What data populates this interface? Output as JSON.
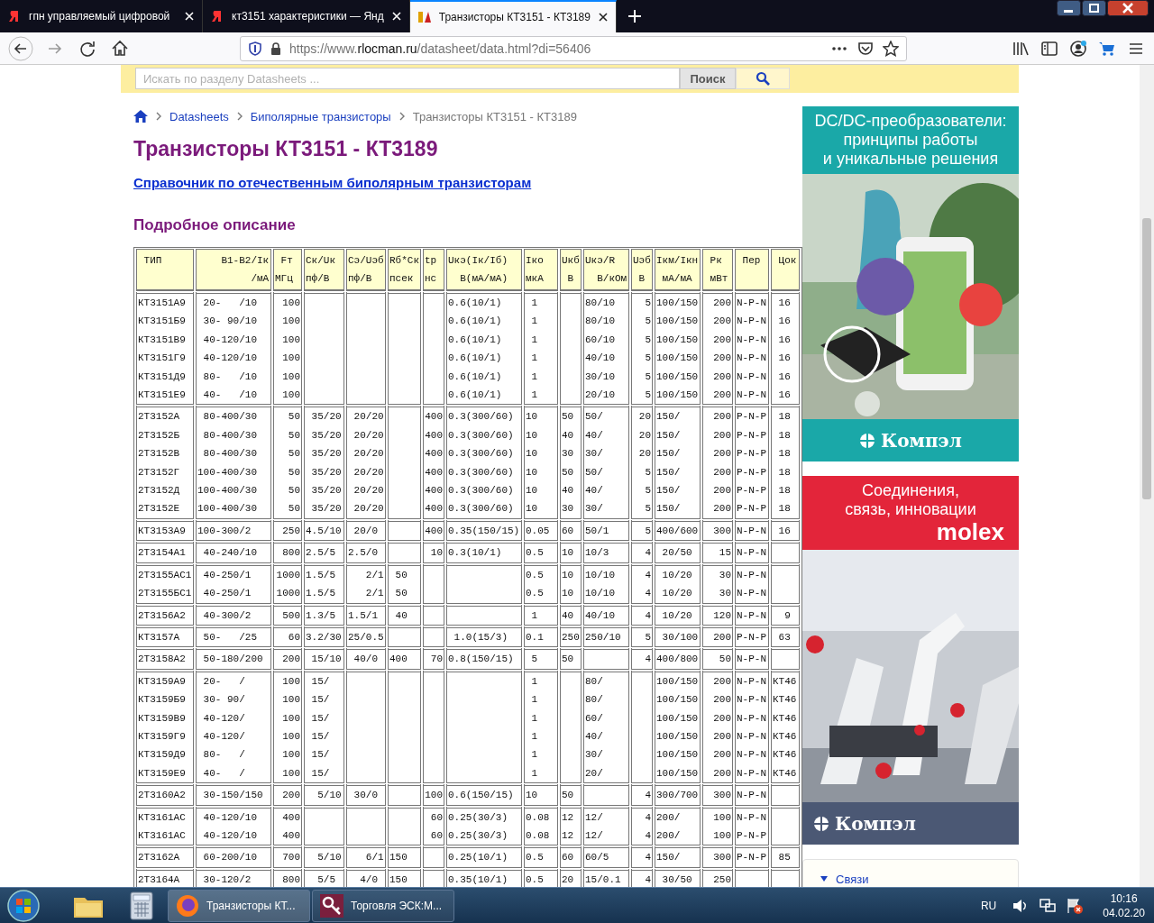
{
  "browser": {
    "tabs": [
      {
        "title": "гпн управляемый цифровой",
        "selected": false
      },
      {
        "title": "кт3151 характеристики — Янд",
        "selected": false
      },
      {
        "title": "Транзисторы КТ3151 - КТ3189",
        "selected": true
      }
    ],
    "url": {
      "scheme": "https://www.",
      "host": "rlocman.ru",
      "path": "/datasheet/data.html?di=56406"
    }
  },
  "search": {
    "placeholder": "Искать по разделу Datasheets ...",
    "button": "Поиск"
  },
  "breadcrumb": [
    "Datasheets",
    "Биполярные транзисторы",
    "Транзисторы КТ3151 - КТ3189"
  ],
  "title": "Транзисторы КТ3151 - КТ3189",
  "reference_link": "Справочник по отечественным биполярным транзисторам",
  "section_heading": "Подробное описание",
  "table": {
    "columns": [
      [
        " ТИП"
      ],
      [
        "    B1-B2/Iк",
        "         /мА"
      ],
      [
        " Fт",
        "МГц"
      ],
      [
        "Cк/Uк",
        "пф/В"
      ],
      [
        "Cэ/Uэб",
        "пф/В"
      ],
      [
        "Rб*Cк",
        "псек"
      ],
      [
        "tр",
        "нс"
      ],
      [
        "Uкэ(Iк/Iб)",
        "  В(мА/мА)"
      ],
      [
        "Iко",
        "мкА"
      ],
      [
        "Uкб",
        " В"
      ],
      [
        "Uкэ/R",
        "  В/кОм"
      ],
      [
        "Uэб",
        " В"
      ],
      [
        "Iкм/Iкн",
        " мА/мА"
      ],
      [
        " Pк",
        " мВт"
      ],
      [
        " Пер"
      ],
      [
        " Цок"
      ]
    ],
    "groups": [
      {
        "rows": [
          [
            "КТ3151А9",
            " 20-   /10",
            "100",
            null,
            null,
            null,
            null,
            "0.6(10/1)",
            " 1",
            null,
            "80/10",
            "5",
            "100/150",
            "200",
            "N-P-N",
            " 16"
          ],
          [
            "КТ3151Б9",
            " 30- 90/10",
            "100",
            null,
            null,
            null,
            null,
            "0.6(10/1)",
            " 1",
            null,
            "80/10",
            "5",
            "100/150",
            "200",
            "N-P-N",
            " 16"
          ],
          [
            "КТ3151В9",
            " 40-120/10",
            "100",
            null,
            null,
            null,
            null,
            "0.6(10/1)",
            " 1",
            null,
            "60/10",
            "5",
            "100/150",
            "200",
            "N-P-N",
            " 16"
          ],
          [
            "КТ3151Г9",
            " 40-120/10",
            "100",
            null,
            null,
            null,
            null,
            "0.6(10/1)",
            " 1",
            null,
            "40/10",
            "5",
            "100/150",
            "200",
            "N-P-N",
            " 16"
          ],
          [
            "КТ3151Д9",
            " 80-   /10",
            "100",
            null,
            null,
            null,
            null,
            "0.6(10/1)",
            " 1",
            null,
            "30/10",
            "5",
            "100/150",
            "200",
            "N-P-N",
            " 16"
          ],
          [
            "КТ3151Е9",
            " 40-   /10",
            "100",
            null,
            null,
            null,
            null,
            "0.6(10/1)",
            " 1",
            null,
            "20/10",
            "5",
            "100/150",
            "200",
            "N-P-N",
            " 16"
          ]
        ]
      },
      {
        "rows": [
          [
            "2Т3152А",
            " 80-400/30",
            "50",
            " 35/20",
            " 20/20",
            null,
            "400",
            "0.3(300/60)",
            "10",
            "50",
            "50/",
            "20",
            "150/",
            "200",
            "P-N-P",
            " 18"
          ],
          [
            "2Т3152Б",
            " 80-400/30",
            "50",
            " 35/20",
            " 20/20",
            null,
            "400",
            "0.3(300/60)",
            "10",
            "40",
            "40/",
            "20",
            "150/",
            "200",
            "P-N-P",
            " 18"
          ],
          [
            "2Т3152В",
            " 80-400/30",
            "50",
            " 35/20",
            " 20/20",
            null,
            "400",
            "0.3(300/60)",
            "10",
            "30",
            "30/",
            "20",
            "150/",
            "200",
            "P-N-P",
            " 18"
          ],
          [
            "2Т3152Г",
            "100-400/30",
            "50",
            " 35/20",
            " 20/20",
            null,
            "400",
            "0.3(300/60)",
            "10",
            "50",
            "50/",
            "5",
            "150/",
            "200",
            "P-N-P",
            " 18"
          ],
          [
            "2Т3152Д",
            "100-400/30",
            "50",
            " 35/20",
            " 20/20",
            null,
            "400",
            "0.3(300/60)",
            "10",
            "40",
            "40/",
            "5",
            "150/",
            "200",
            "P-N-P",
            " 18"
          ],
          [
            "2Т3152Е",
            "100-400/30",
            "50",
            " 35/20",
            " 20/20",
            null,
            "400",
            "0.3(300/60)",
            "10",
            "30",
            "30/",
            "5",
            "150/",
            "200",
            "P-N-P",
            " 18"
          ]
        ]
      },
      {
        "rows": [
          [
            "КТ3153А9",
            "100-300/2",
            "250",
            "4.5/10",
            " 20/0",
            null,
            "400",
            "0.35(150/15)",
            "0.05",
            "60",
            "50/1",
            "5",
            "400/600",
            "300",
            "N-P-N",
            " 16"
          ]
        ]
      },
      {
        "rows": [
          [
            "2Т3154А1",
            " 40-240/10",
            "800",
            "2.5/5",
            "2.5/0",
            null,
            "10",
            "0.3(10/1)",
            "0.5",
            "10",
            "10/3",
            "4",
            " 20/50",
            "15",
            "N-P-N",
            null
          ]
        ]
      },
      {
        "rows": [
          [
            "2Т3155АС1",
            " 40-250/1",
            "1000",
            "1.5/5",
            "   2/1",
            " 50",
            null,
            null,
            "0.5",
            "10",
            "10/10",
            "4",
            " 10/20",
            "30",
            "N-P-N",
            null
          ],
          [
            "2Т3155БС1",
            " 40-250/1",
            "1000",
            "1.5/5",
            "   2/1",
            " 50",
            null,
            null,
            "0.5",
            "10",
            "10/10",
            "4",
            " 10/20",
            "30",
            "N-P-N",
            null
          ]
        ]
      },
      {
        "rows": [
          [
            "2Т3156А2",
            " 40-300/2",
            "500",
            "1.3/5",
            "1.5/1",
            " 40",
            null,
            null,
            " 1",
            "40",
            "40/10",
            "4",
            " 10/20",
            "120",
            "N-P-N",
            "  9"
          ]
        ]
      },
      {
        "rows": [
          [
            "КТ3157А",
            " 50-   /25",
            "60",
            "3.2/30",
            "25/0.5",
            null,
            null,
            " 1.0(15/3)",
            "0.1",
            "250",
            "250/10",
            "5",
            " 30/100",
            "200",
            "P-N-P",
            " 63"
          ]
        ]
      },
      {
        "rows": [
          [
            "2Т3158А2",
            " 50-180/200",
            "200",
            " 15/10",
            " 40/0",
            "400",
            "70",
            "0.8(150/15)",
            " 5",
            "50",
            null,
            "4",
            "400/800",
            "50",
            "N-P-N",
            null
          ]
        ]
      },
      {
        "rows": [
          [
            "КТ3159А9",
            " 20-   /",
            "100",
            " 15/",
            null,
            null,
            null,
            null,
            " 1",
            null,
            "80/",
            null,
            "100/150",
            "200",
            "N-P-N",
            "КТ46"
          ],
          [
            "КТ3159Б9",
            " 30- 90/",
            "100",
            " 15/",
            null,
            null,
            null,
            null,
            " 1",
            null,
            "80/",
            null,
            "100/150",
            "200",
            "N-P-N",
            "КТ46"
          ],
          [
            "КТ3159В9",
            " 40-120/",
            "100",
            " 15/",
            null,
            null,
            null,
            null,
            " 1",
            null,
            "60/",
            null,
            "100/150",
            "200",
            "N-P-N",
            "КТ46"
          ],
          [
            "КТ3159Г9",
            " 40-120/",
            "100",
            " 15/",
            null,
            null,
            null,
            null,
            " 1",
            null,
            "40/",
            null,
            "100/150",
            "200",
            "N-P-N",
            "КТ46"
          ],
          [
            "КТ3159Д9",
            " 80-   /",
            "100",
            " 15/",
            null,
            null,
            null,
            null,
            " 1",
            null,
            "30/",
            null,
            "100/150",
            "200",
            "N-P-N",
            "КТ46"
          ],
          [
            "КТ3159Е9",
            " 40-   /",
            "100",
            " 15/",
            null,
            null,
            null,
            null,
            " 1",
            null,
            "20/",
            null,
            "100/150",
            "200",
            "N-P-N",
            "КТ46"
          ]
        ]
      },
      {
        "rows": [
          [
            "2Т3160А2",
            " 30-150/150",
            "200",
            "  5/10",
            " 30/0",
            null,
            "100",
            "0.6(150/15)",
            "10",
            "50",
            null,
            "4",
            "300/700",
            "300",
            "N-P-N",
            null
          ]
        ]
      },
      {
        "rows": [
          [
            "КТ3161АС",
            " 40-120/10",
            "400",
            null,
            null,
            null,
            "60",
            "0.25(30/3)",
            "0.08",
            "12",
            "12/",
            "4",
            "200/",
            "100",
            "N-P-N",
            null
          ],
          [
            "КТ3161АС",
            " 40-120/10",
            "400",
            null,
            null,
            null,
            "60",
            "0.25(30/3)",
            "0.08",
            "12",
            "12/",
            "4",
            "200/",
            "100",
            "P-N-P",
            null
          ]
        ]
      },
      {
        "rows": [
          [
            "2Т3162А",
            " 60-200/10",
            "700",
            "  5/10",
            "   6/1",
            "150",
            null,
            "0.25(10/1)",
            "0.5",
            "60",
            "60/5",
            "4",
            "150/",
            "300",
            "P-N-P",
            " 85"
          ]
        ]
      },
      {
        "rows": [
          [
            "2Т3164А",
            " 30-120/2",
            "800",
            "  5/5",
            "  4/0",
            "150",
            null,
            "0.35(10/1)",
            "0.5",
            "20",
            "15/0.1",
            "4",
            " 30/50",
            "250",
            null,
            null
          ]
        ]
      }
    ]
  },
  "ads": [
    {
      "headline": [
        "DC/DC-преобразователи:",
        "принципы работы",
        "и уникальные решения"
      ],
      "color": "#1aa8a8",
      "kind": "gadget",
      "footer": "Компэл"
    },
    {
      "headline": [
        "Соединения,",
        "связь, инновации"
      ],
      "brand": "molex",
      "color": "#e3253a",
      "kind": "factory",
      "footer": "Компэл"
    }
  ],
  "side_box": {
    "link": "Связи"
  },
  "taskbar": {
    "buttons": [
      {
        "label": "Транзисторы КТ...",
        "kind": "firefox",
        "selected": true
      },
      {
        "label": "Торговля ЭСК:М...",
        "kind": "key",
        "selected": false
      }
    ],
    "language": "RU",
    "time": "10:16",
    "date": "04.02.20"
  }
}
